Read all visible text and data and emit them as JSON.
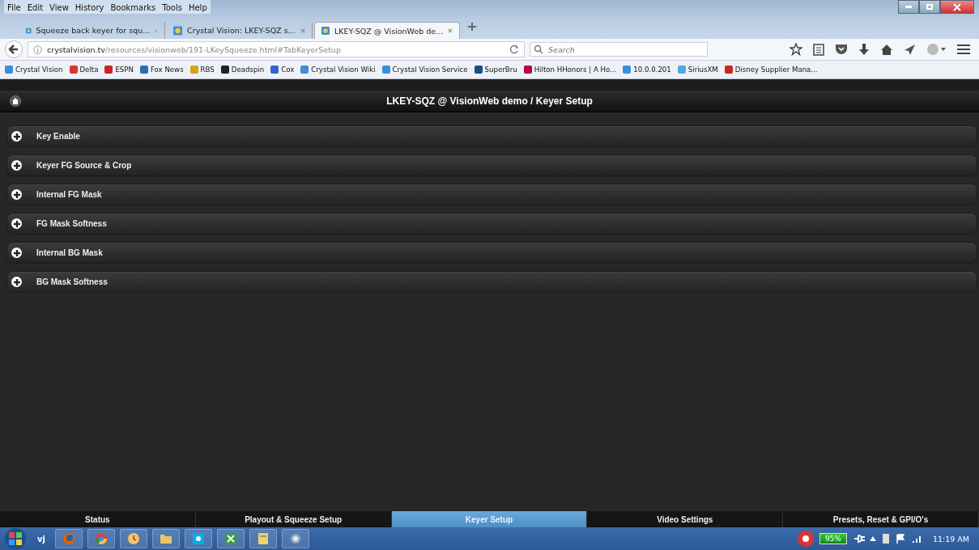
{
  "menu": [
    "File",
    "Edit",
    "View",
    "History",
    "Bookmarks",
    "Tools",
    "Help"
  ],
  "browser_tabs": [
    {
      "title": "Squeeze back keyer for squ...",
      "selected": false
    },
    {
      "title": "Crystal Vision: LKEY-SQZ s...",
      "selected": false
    },
    {
      "title": "LKEY-SQZ @ VisionWeb de...",
      "selected": true
    }
  ],
  "address": {
    "host": "crystalvision.tv",
    "path": "/resources/visionweb/191-LKeySqueeze.html#TabKeyerSetup"
  },
  "search": {
    "placeholder": "Search"
  },
  "bookmarks": [
    "Crystal Vision",
    "Delta",
    "ESPN",
    "Fox News",
    "RBS",
    "Deadspin",
    "Cox",
    "Crystal Vision Wiki",
    "Crystal Vision Service",
    "SuperBru",
    "Hilton HHonors | A Ho...",
    "10.0.0.201",
    "SiriusXM",
    "Disney Supplier Mana..."
  ],
  "page_title": "LKEY-SQZ @ VisionWeb demo / Keyer Setup",
  "sections": [
    {
      "label": "Key Enable",
      "expanded": false
    },
    {
      "label": "Keyer FG Source & Crop",
      "expanded": false
    },
    {
      "label": "Internal FG Mask",
      "expanded": false
    },
    {
      "label": "FG Mask Softness",
      "expanded": false
    },
    {
      "label": "Internal BG Mask",
      "expanded": false
    },
    {
      "label": "BG Mask Softness",
      "expanded": false
    }
  ],
  "bottom_tabs": [
    {
      "label": "Status",
      "selected": false
    },
    {
      "label": "Playout & Squeeze Setup",
      "selected": false
    },
    {
      "label": "Keyer Setup",
      "selected": true
    },
    {
      "label": "Video Settings",
      "selected": false
    },
    {
      "label": "Presets, Reset & GPI/O's",
      "selected": false
    }
  ],
  "taskbar": {
    "label": "vj",
    "battery": "95%",
    "time": "11:19 AM"
  }
}
